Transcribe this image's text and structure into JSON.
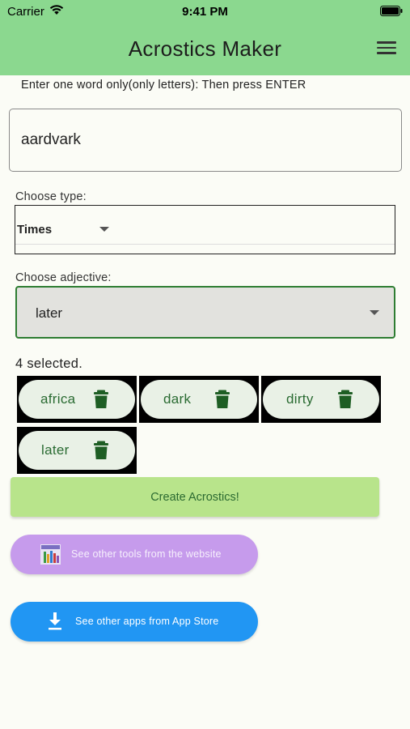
{
  "status_bar": {
    "carrier": "Carrier",
    "time": "9:41 PM"
  },
  "header": {
    "title": "Acrostics Maker"
  },
  "instruction": "Enter one word only(only letters): Then press ENTER",
  "word_input": {
    "value": "aardvark"
  },
  "type_select": {
    "label": "Choose type:",
    "value": "Times"
  },
  "adjective_select": {
    "label": "Choose adjective:",
    "value": "later"
  },
  "selection": {
    "count_text": "4 selected.",
    "chips": [
      "africa",
      "dark",
      "dirty",
      "later"
    ]
  },
  "buttons": {
    "create": "Create Acrostics!",
    "website": "See other tools from the website",
    "app_store": "See other apps from App Store"
  },
  "colors": {
    "header_bg": "#8bd88f",
    "create_bg": "#b8e48b",
    "website_bg": "#c69bec",
    "store_bg": "#2196f3",
    "accent_green": "#2e7d32"
  }
}
